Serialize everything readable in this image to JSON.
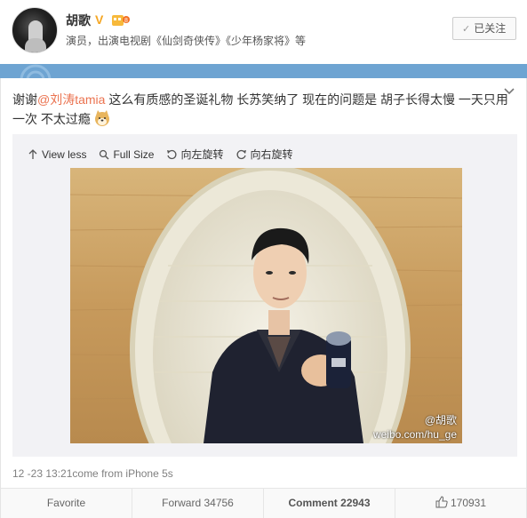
{
  "user": {
    "name": "胡歌",
    "verified_icon": "verified-v-icon",
    "level_icon": "level-badge-icon",
    "description": "演员，出演电视剧《仙剑奇侠传》《少年杨家将》等"
  },
  "follow_button": {
    "label": "已关注",
    "icon": "check-icon"
  },
  "post": {
    "text_pre": "谢谢",
    "mention": "@刘涛tamia",
    "text_post": " 这么有质感的圣诞礼物 长苏笑纳了 现在的问题是 胡子长得太慢 一天只用一次 不太过瘾",
    "emoji": "doge-emoji-icon"
  },
  "media_tools": {
    "view_less": "View less",
    "full_size": "Full Size",
    "rotate_left": "向左旋转",
    "rotate_right": "向右旋转"
  },
  "photo": {
    "watermark_user": "@胡歌",
    "watermark_url": "weibo.com/hu_ge"
  },
  "meta": "12 -23 13:21come from iPhone 5s",
  "actions": {
    "favorite": "Favorite",
    "forward": "Forward 34756",
    "comment": "Comment 22943",
    "like": "170931"
  },
  "colors": {
    "accent_orange": "#eb7350",
    "blue_bar": "#6ea4d2",
    "verified_gold": "#f5a623"
  }
}
